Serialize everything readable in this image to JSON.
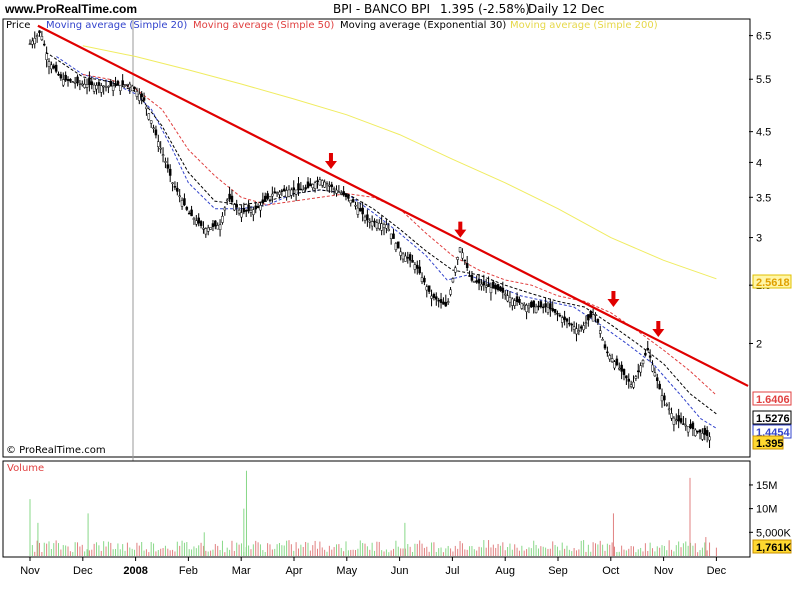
{
  "header": {
    "site": "www.ProRealTime.com",
    "title": "BPI - BANCO BPI",
    "quote": "1.395 (-2.58%)",
    "period": "Daily",
    "date": "12 Dec"
  },
  "watermark": "© ProRealTime.com",
  "legend": {
    "price": "Price",
    "sma20": "Moving average (Simple 20)",
    "sma50": "Moving average (Simple 50)",
    "ema30": "Moving average (Exponential 30)",
    "sma200": "Moving average (Simple 200)",
    "volume": "Volume"
  },
  "colors": {
    "sma20": "#3344cc",
    "sma50": "#e04040",
    "ema30": "#000000",
    "sma200": "#f0ec60",
    "trendline": "#e00000",
    "arrow": "#e00000",
    "volume": "#88d888"
  },
  "last_values": {
    "sma200": "2.5618",
    "sma50": "1.6406",
    "ema30": "1.5276",
    "sma20": "1.4454",
    "price": "1.395",
    "volume": "1,761K"
  },
  "chart_data": {
    "type": "line",
    "scale": "log",
    "x": [
      "Nov",
      "Dec",
      "2008",
      "Feb",
      "Mar",
      "Apr",
      "May",
      "Jun",
      "Jul",
      "Aug",
      "Sep",
      "Oct",
      "Nov",
      "Dec"
    ],
    "price_ticks": [
      "6.5",
      "5.5",
      "4.5",
      "4",
      "3.5",
      "3",
      "2.5",
      "2"
    ],
    "volume_ticks": [
      "15M",
      "10M",
      "5,000K"
    ],
    "ylim": [
      1.3,
      6.9
    ],
    "series": [
      {
        "name": "Price",
        "points": [
          [
            0,
            6.3
          ],
          [
            0.2,
            6.6
          ],
          [
            0.35,
            5.9
          ],
          [
            0.6,
            5.5
          ],
          [
            1,
            5.4
          ],
          [
            1.5,
            5.35
          ],
          [
            1.9,
            5.4
          ],
          [
            2.15,
            5.1
          ],
          [
            2.4,
            4.4
          ],
          [
            2.7,
            3.7
          ],
          [
            3,
            3.3
          ],
          [
            3.3,
            3.1
          ],
          [
            3.6,
            3.15
          ],
          [
            3.75,
            3.5
          ],
          [
            4,
            3.3
          ],
          [
            4.3,
            3.35
          ],
          [
            4.6,
            3.55
          ],
          [
            4.9,
            3.6
          ],
          [
            5.2,
            3.6
          ],
          [
            5.5,
            3.75
          ],
          [
            5.8,
            3.6
          ],
          [
            6.1,
            3.45
          ],
          [
            6.4,
            3.2
          ],
          [
            6.75,
            3.15
          ],
          [
            7,
            2.85
          ],
          [
            7.3,
            2.7
          ],
          [
            7.6,
            2.4
          ],
          [
            7.9,
            2.3
          ],
          [
            8.15,
            2.9
          ],
          [
            8.35,
            2.55
          ],
          [
            8.6,
            2.5
          ],
          [
            8.9,
            2.45
          ],
          [
            9.2,
            2.35
          ],
          [
            9.5,
            2.3
          ],
          [
            9.8,
            2.3
          ],
          [
            10.1,
            2.2
          ],
          [
            10.4,
            2.1
          ],
          [
            10.7,
            2.25
          ],
          [
            10.9,
            1.95
          ],
          [
            11.1,
            1.85
          ],
          [
            11.4,
            1.7
          ],
          [
            11.7,
            1.95
          ],
          [
            11.95,
            1.65
          ],
          [
            12.2,
            1.5
          ],
          [
            12.5,
            1.45
          ],
          [
            12.9,
            1.395
          ]
        ]
      },
      {
        "name": "Moving average (Simple 20)",
        "points": [
          [
            0.5,
            6.0
          ],
          [
            1,
            5.6
          ],
          [
            1.5,
            5.45
          ],
          [
            2,
            5.2
          ],
          [
            2.3,
            4.9
          ],
          [
            2.7,
            4.2
          ],
          [
            3,
            3.7
          ],
          [
            3.5,
            3.35
          ],
          [
            4,
            3.35
          ],
          [
            4.5,
            3.4
          ],
          [
            5,
            3.55
          ],
          [
            5.5,
            3.6
          ],
          [
            6,
            3.55
          ],
          [
            6.5,
            3.3
          ],
          [
            7,
            3.05
          ],
          [
            7.5,
            2.8
          ],
          [
            7.9,
            2.55
          ],
          [
            8.3,
            2.6
          ],
          [
            8.8,
            2.5
          ],
          [
            9.3,
            2.4
          ],
          [
            9.8,
            2.35
          ],
          [
            10.3,
            2.3
          ],
          [
            10.8,
            2.15
          ],
          [
            11.3,
            2.0
          ],
          [
            11.8,
            1.85
          ],
          [
            12.3,
            1.65
          ],
          [
            12.7,
            1.5
          ],
          [
            13,
            1.4454
          ]
        ]
      },
      {
        "name": "Moving average (Simple 50)",
        "points": [
          [
            1,
            5.6
          ],
          [
            1.5,
            5.5
          ],
          [
            2,
            5.3
          ],
          [
            2.5,
            4.9
          ],
          [
            3,
            4.2
          ],
          [
            3.5,
            3.8
          ],
          [
            4,
            3.5
          ],
          [
            4.5,
            3.4
          ],
          [
            5,
            3.45
          ],
          [
            5.5,
            3.5
          ],
          [
            6,
            3.55
          ],
          [
            6.5,
            3.5
          ],
          [
            7,
            3.35
          ],
          [
            7.5,
            3.05
          ],
          [
            8,
            2.8
          ],
          [
            8.5,
            2.65
          ],
          [
            9,
            2.55
          ],
          [
            9.5,
            2.5
          ],
          [
            10,
            2.4
          ],
          [
            10.5,
            2.35
          ],
          [
            11,
            2.25
          ],
          [
            11.5,
            2.1
          ],
          [
            12,
            1.95
          ],
          [
            12.5,
            1.8
          ],
          [
            13,
            1.6406
          ]
        ]
      },
      {
        "name": "Moving average (Exponential 30)",
        "points": [
          [
            0.3,
            6.1
          ],
          [
            1,
            5.55
          ],
          [
            1.5,
            5.45
          ],
          [
            2,
            5.25
          ],
          [
            2.5,
            4.6
          ],
          [
            3,
            3.85
          ],
          [
            3.5,
            3.45
          ],
          [
            4,
            3.4
          ],
          [
            4.5,
            3.45
          ],
          [
            5,
            3.55
          ],
          [
            5.5,
            3.6
          ],
          [
            6,
            3.55
          ],
          [
            6.5,
            3.35
          ],
          [
            7,
            3.1
          ],
          [
            7.5,
            2.85
          ],
          [
            8,
            2.65
          ],
          [
            8.5,
            2.6
          ],
          [
            9,
            2.5
          ],
          [
            9.5,
            2.42
          ],
          [
            10,
            2.35
          ],
          [
            10.5,
            2.3
          ],
          [
            11,
            2.15
          ],
          [
            11.5,
            2.0
          ],
          [
            12,
            1.85
          ],
          [
            12.5,
            1.65
          ],
          [
            13,
            1.5276
          ]
        ]
      },
      {
        "name": "Moving average (Simple 200)",
        "points": [
          [
            1,
            6.25
          ],
          [
            2,
            6.0
          ],
          [
            3,
            5.7
          ],
          [
            4,
            5.4
          ],
          [
            5,
            5.1
          ],
          [
            6,
            4.8
          ],
          [
            7,
            4.45
          ],
          [
            8,
            4.05
          ],
          [
            9,
            3.7
          ],
          [
            10,
            3.35
          ],
          [
            11,
            3.0
          ],
          [
            12,
            2.75
          ],
          [
            13,
            2.5618
          ]
        ]
      }
    ],
    "trendline": [
      [
        0.15,
        6.75
      ],
      [
        13.6,
        1.7
      ]
    ],
    "arrow_markers": [
      [
        5.7,
        3.9
      ],
      [
        8.15,
        3.0
      ],
      [
        11.05,
        2.3
      ],
      [
        11.9,
        2.05
      ]
    ],
    "volume": {
      "spikes": [
        [
          0,
          12
        ],
        [
          0.15,
          7
        ],
        [
          1.1,
          9
        ],
        [
          3.3,
          5
        ],
        [
          4.1,
          18
        ],
        [
          4.05,
          10
        ],
        [
          7.1,
          7
        ],
        [
          11.05,
          9
        ],
        [
          12.5,
          16.5
        ],
        [
          12.8,
          4
        ],
        [
          13,
          1.761
        ]
      ],
      "typical": 2
    }
  }
}
